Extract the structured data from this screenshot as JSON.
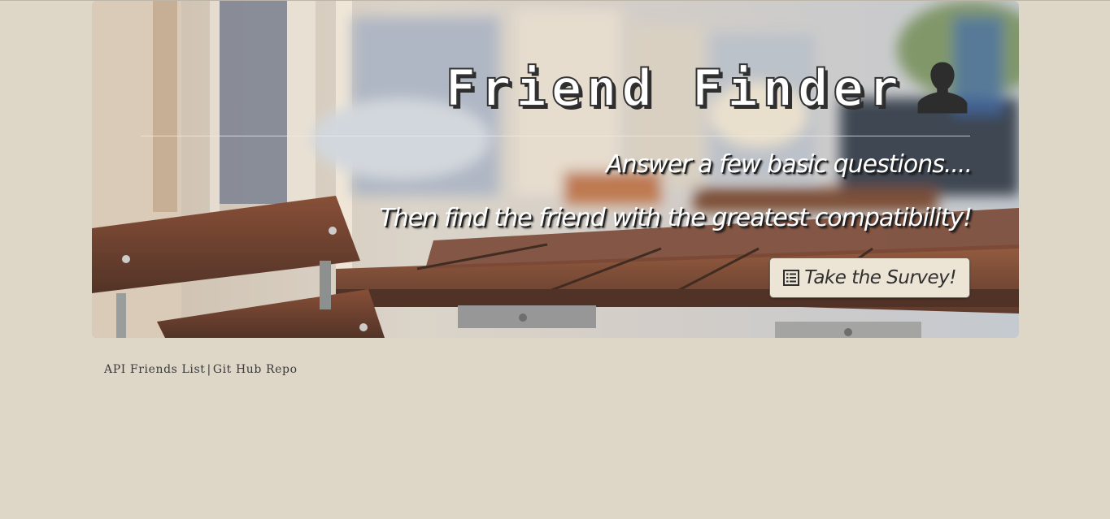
{
  "hero": {
    "title": "Friend Finder",
    "icon": "person-icon",
    "tagline_1": "Answer a few basic questions....",
    "tagline_2": "Then find the friend with the greatest compatibility!",
    "survey_button": {
      "label": "Take the Survey!",
      "icon": "list-icon"
    }
  },
  "footer": {
    "links": [
      {
        "label": "API Friends List"
      },
      {
        "label": "Git Hub Repo"
      }
    ],
    "separator": "|"
  },
  "colors": {
    "page_background": "#ded7c8",
    "button_background": "#ece4d5",
    "title_fill": "#ffffff",
    "title_shadow": "#2e2e2e",
    "link_text": "#3a3a3a"
  }
}
